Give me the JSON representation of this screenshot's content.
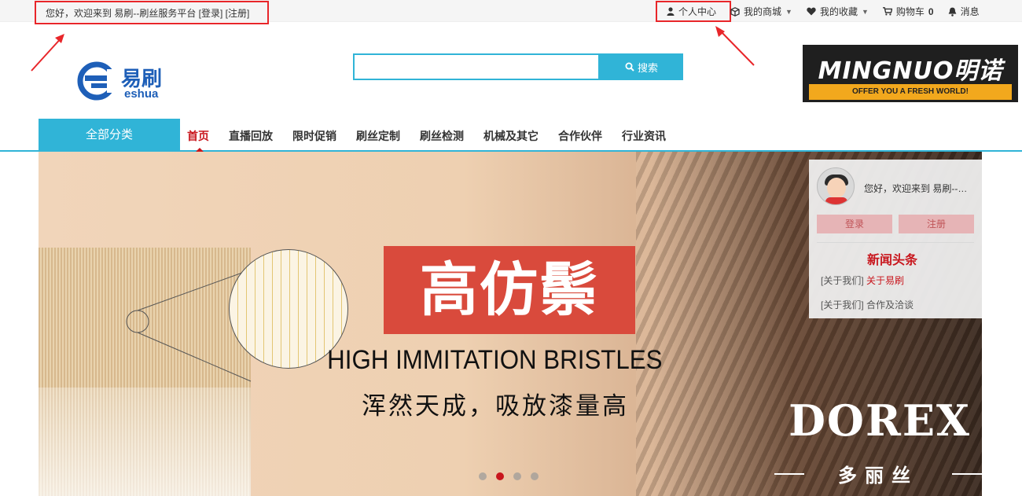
{
  "topbar": {
    "welcome": "您好，欢迎来到 易刷--刷丝服务平台 [登录] [注册]",
    "personal_center": "个人中心",
    "my_mall": "我的商城",
    "my_favorites": "我的收藏",
    "cart_label": "购物车",
    "cart_count": "0",
    "messages": "消息"
  },
  "logo": {
    "cn": "易刷",
    "en": "eshua"
  },
  "search": {
    "placeholder": "",
    "button": "搜索"
  },
  "ad": {
    "title": "MINGNUO明诺",
    "tagline": "OFFER YOU A FRESH WORLD!"
  },
  "nav": {
    "all_categories": "全部分类",
    "items": [
      "首页",
      "直播回放",
      "限时促销",
      "刷丝定制",
      "刷丝检测",
      "机械及其它",
      "合作伙伴",
      "行业资讯"
    ]
  },
  "banner": {
    "headline": "高仿鬃",
    "english": "HIGH IMMITATION BRISTLES",
    "subtitle": "浑然天成，吸放漆量高",
    "brand": "DOREX",
    "brand_cn": "多丽丝",
    "active_slide": 2,
    "slide_count": 4
  },
  "panel": {
    "greeting": "您好，欢迎来到 易刷--刷丝服务平台",
    "login": "登录",
    "register": "注册",
    "news_title": "新闻头条",
    "news": [
      {
        "tag": "[关于我们]",
        "title": "关于易刷",
        "highlight": true
      },
      {
        "tag": "[关于我们]",
        "title": "合作及洽谈",
        "highlight": false
      }
    ]
  },
  "colors": {
    "accent": "#30b4d7",
    "brand_red": "#c8161d",
    "annotation_red": "#e8262a"
  }
}
